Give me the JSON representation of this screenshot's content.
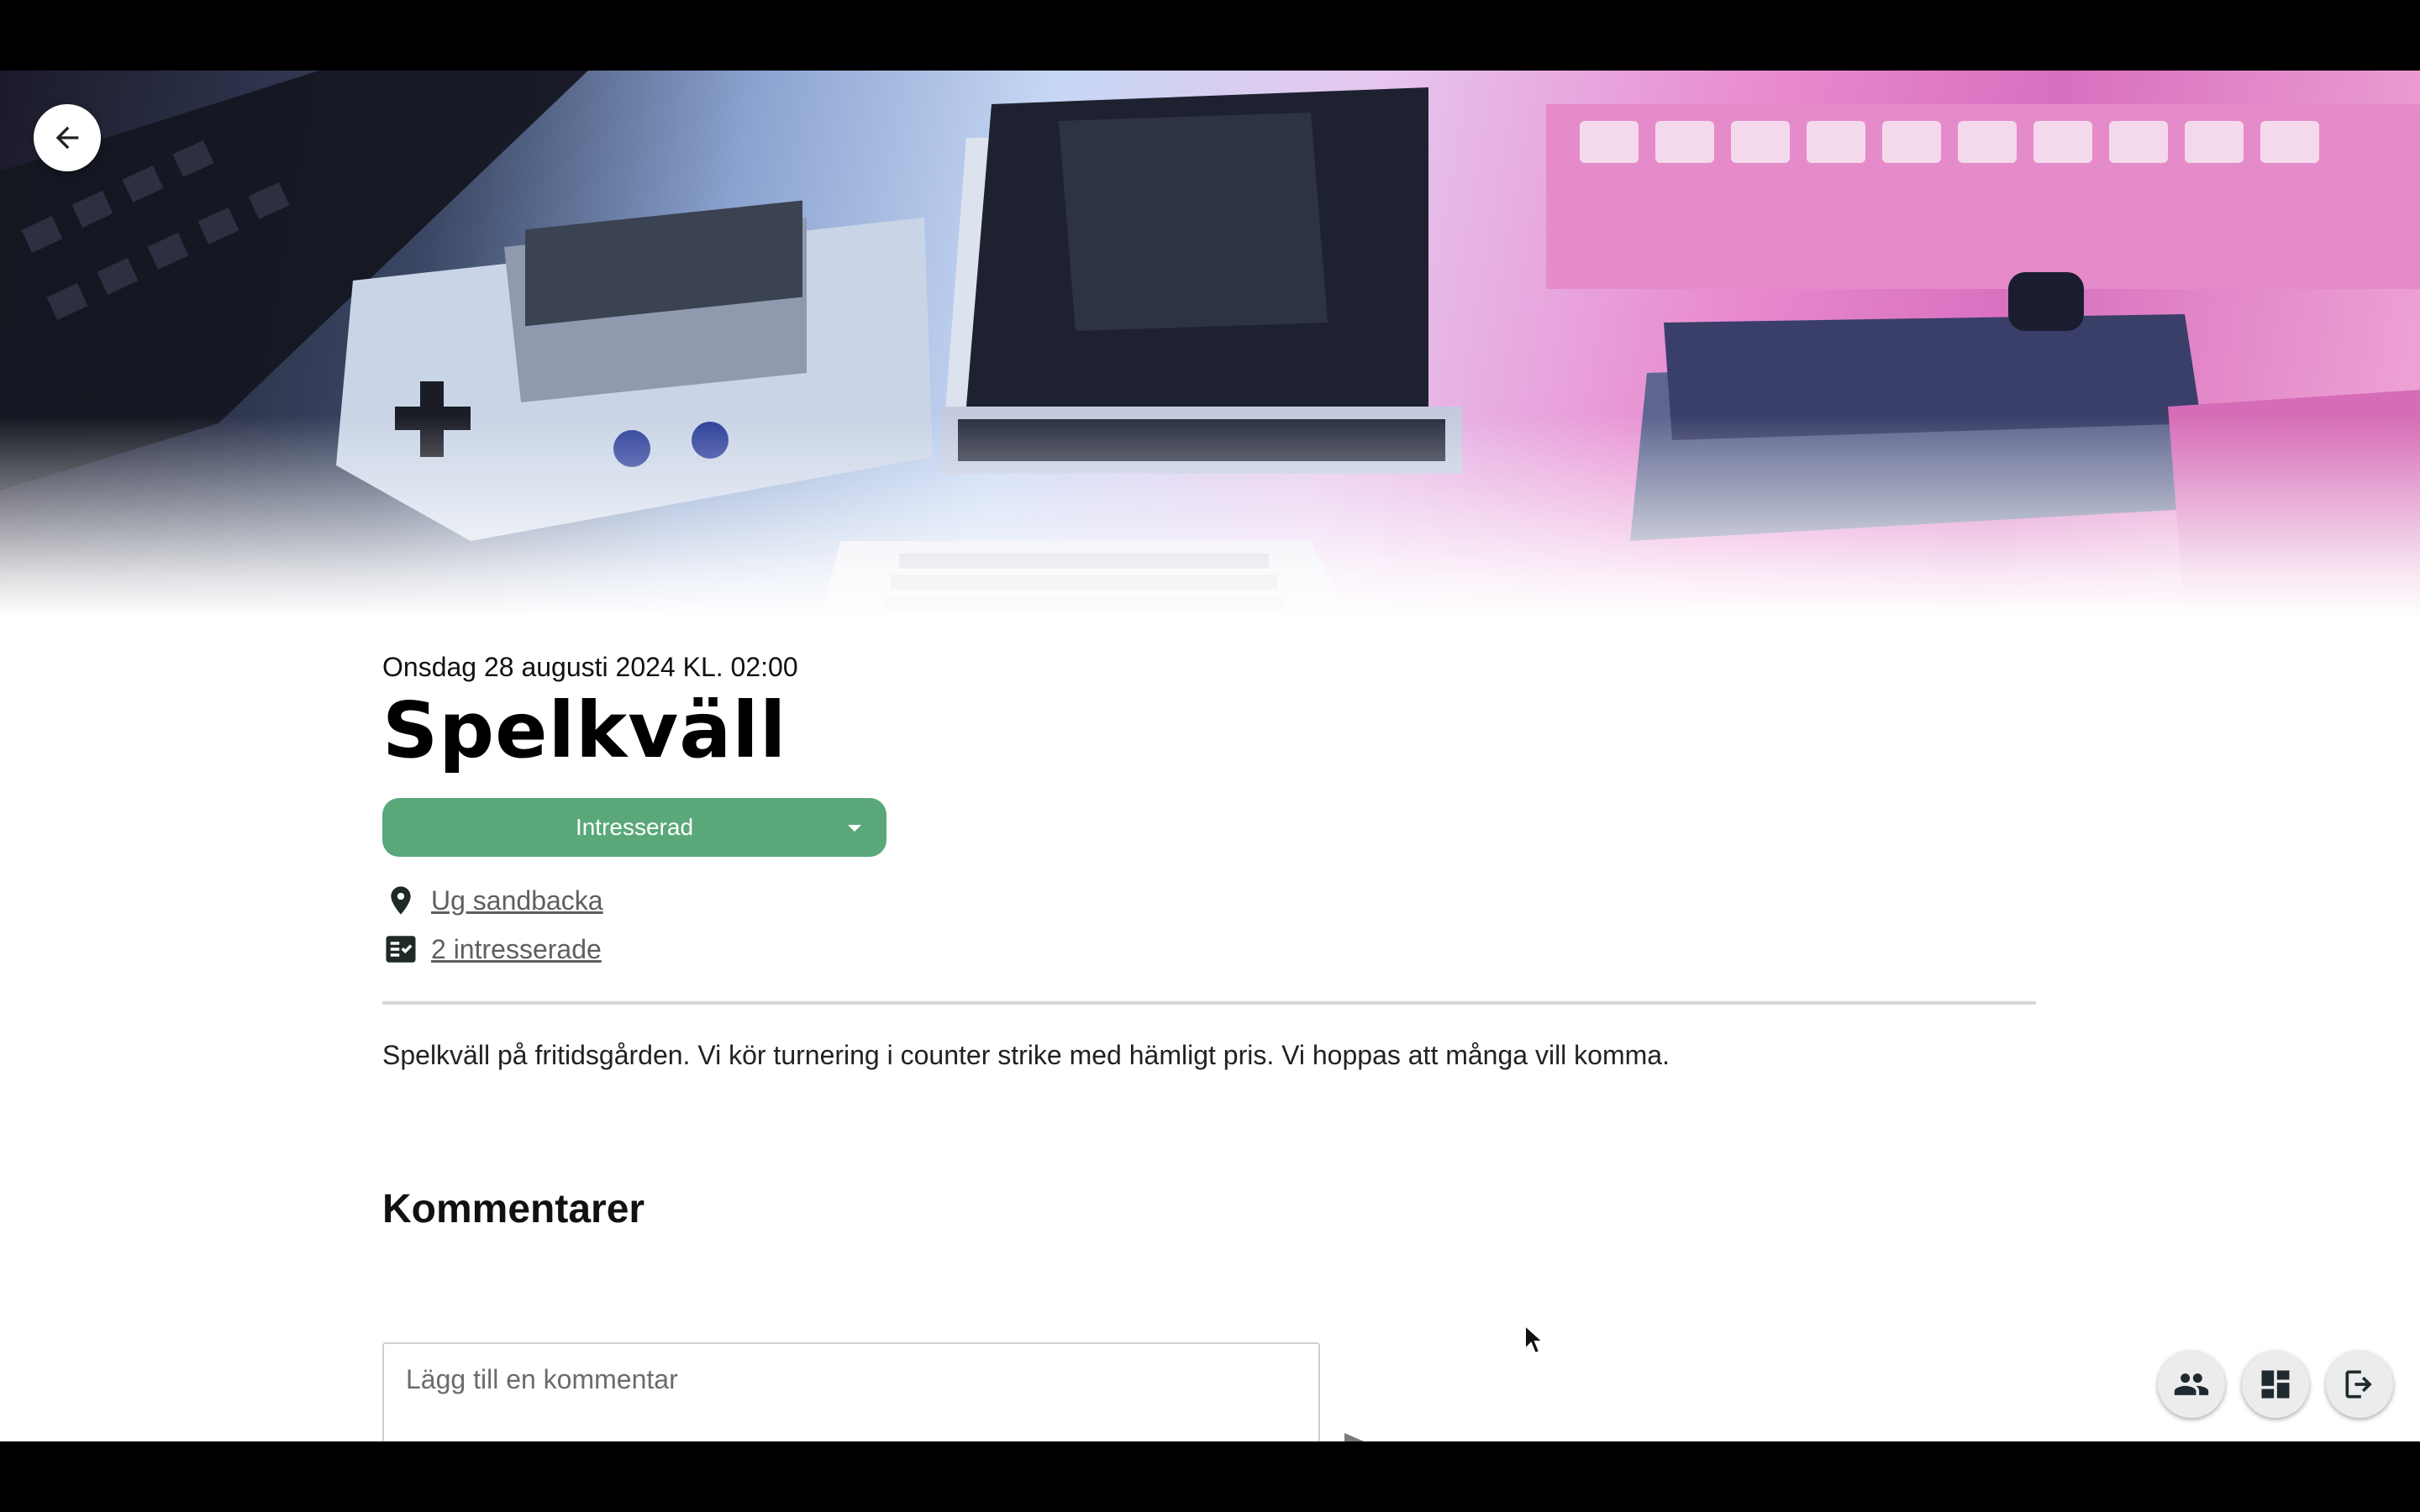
{
  "event": {
    "date": "Onsdag 28 augusti 2024 KL. 02:00",
    "title": "Spelkväll",
    "status_label": "Intresserad",
    "location_label": "Ug sandbacka",
    "interested_label": "2 intresserade",
    "description": "Spelkväll på fritidsgården. Vi kör turnering i counter strike med hämligt pris. Vi hoppas att många vill komma."
  },
  "comments": {
    "heading": "Kommentarer",
    "placeholder": "Lägg till en kommentar"
  },
  "icons": {
    "back": "arrow-back-icon",
    "location": "location-pin-icon",
    "interested": "checklist-icon",
    "send": "send-icon",
    "dropdown": "caret-down-icon",
    "people": "people-icon",
    "dashboard": "dashboard-icon",
    "logout": "logout-icon"
  },
  "colors": {
    "status_button": "#5aa87a",
    "icon_dark": "#1f2a24"
  }
}
